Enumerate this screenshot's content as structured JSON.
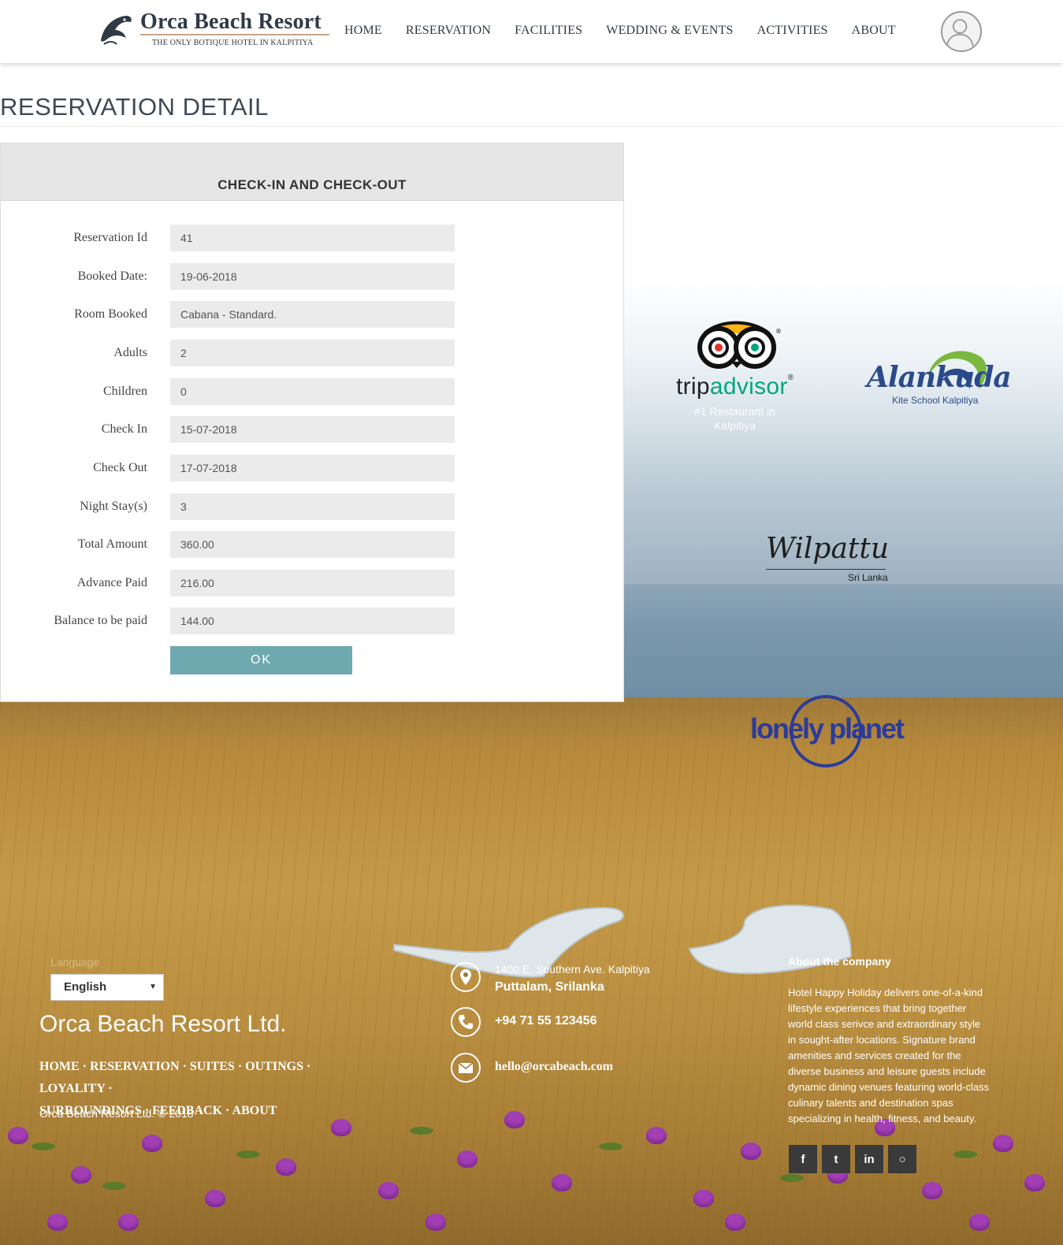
{
  "header": {
    "brand": "Orca Beach Resort",
    "tagline": "THE ONLY BOTIQUE HOTEL IN KALPITIYA",
    "nav": [
      "HOME",
      "RESERVATION",
      "FACILITIES",
      "WEDDING & EVENTS",
      "ACTIVITIES",
      "ABOUT"
    ],
    "avatar_icon": "user-avatar-icon"
  },
  "page": {
    "title": "RESERVATION DETAIL"
  },
  "card": {
    "heading": "CHECK-IN AND CHECK-OUT",
    "fields": [
      {
        "label": "Reservation Id",
        "value": "41"
      },
      {
        "label": "Booked Date:",
        "value": "19-06-2018"
      },
      {
        "label": "Room Booked",
        "value": "Cabana - Standard."
      },
      {
        "label": "Adults",
        "value": "2"
      },
      {
        "label": "Children",
        "value": "0"
      },
      {
        "label": "Check In",
        "value": "15-07-2018"
      },
      {
        "label": "Check Out",
        "value": "17-07-2018"
      },
      {
        "label": "Night Stay(s)",
        "value": "3"
      },
      {
        "label": "Total Amount",
        "value": "360.00"
      },
      {
        "label": "Advance Paid",
        "value": "216.00"
      },
      {
        "label": "Balance to be paid",
        "value": "144.00"
      }
    ],
    "ok_label": "OK"
  },
  "partners": {
    "tripadvisor": {
      "trip": "trip",
      "advisor": "advisor",
      "reg": "®",
      "subtitle": "#1 Restaurant in Kalpitiya"
    },
    "alankuda": {
      "name": "Alankuda",
      "subtitle": "Kite School Kalpitiya"
    },
    "wilpattu": {
      "name": "Wilpattu",
      "subtitle": "Sri Lanka"
    },
    "lonely_planet": {
      "name": "lonely planet"
    }
  },
  "footer": {
    "language_label": "Language",
    "language_value": "English",
    "company": "Orca Beach Resort Ltd.",
    "links": [
      "HOME",
      "RESERVATION",
      "SUITES",
      "OUTINGS",
      "LOYALITY",
      "SURROUNDINGS",
      "FEEDBACK",
      "ABOUT"
    ],
    "separator": "·",
    "copyright": "Orca Beach Resort Ltd. © 2018",
    "address_line1": "1400 E. Southern Ave. Kalpitiya",
    "address_line2": "Puttalam, Srilanka",
    "phone": "+94 71 55 123456",
    "email": "hello@orcabeach.com",
    "about_heading": "About the company",
    "about_text": "Hotel Happy Holiday delivers one-of-a-kind lifestyle experiences that bring together world class serivce and extraordinary style in sought-after locations. Signature brand amenities and services created for the diverse business and leisure guests include dynamic dining venues featuring world-class culinary talents and destination spas specializing in health, fitness, and beauty.",
    "social": [
      {
        "name": "facebook-icon",
        "glyph": "f"
      },
      {
        "name": "twitter-icon",
        "glyph": "t"
      },
      {
        "name": "linkedin-icon",
        "glyph": "in"
      },
      {
        "name": "github-icon",
        "glyph": "○"
      }
    ]
  },
  "colors": {
    "accent_button": "#6fa9b0",
    "text_dark": "#2f3a45",
    "field_bg": "#ebebeb",
    "tripadvisor_green": "#00a680",
    "lonely_planet_blue": "#2b3c9a"
  }
}
